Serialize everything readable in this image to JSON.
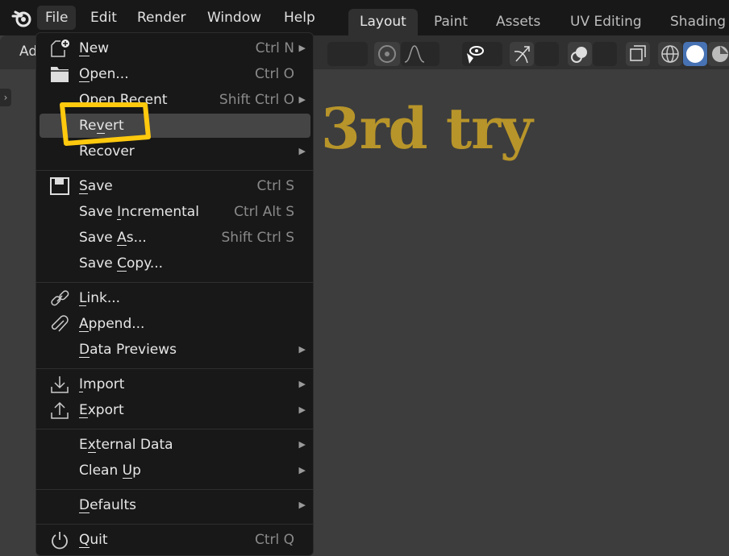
{
  "topbar": {
    "menus": [
      "File",
      "Edit",
      "Render",
      "Window",
      "Help"
    ],
    "active_menu": "File",
    "workspace_tabs": [
      "Layout",
      "Paint",
      "Assets",
      "UV Editing",
      "Shading"
    ],
    "active_tab": "Layout"
  },
  "toolbar": {
    "left_label": "Ad"
  },
  "viewport": {
    "text": "3rd try",
    "text_color": "#b8952a"
  },
  "file_menu": {
    "items": [
      {
        "label": "New",
        "u": "N",
        "shortcut": "Ctrl N",
        "submenu": true,
        "icon": "new-file-icon"
      },
      {
        "label": "Open...",
        "u": "O",
        "shortcut": "Ctrl O",
        "icon": "folder-icon"
      },
      {
        "label": "Open Recent",
        "shortcut": "Shift Ctrl O",
        "submenu": true
      },
      {
        "label": "Revert",
        "u": "v",
        "highlighted": true
      },
      {
        "label": "Recover",
        "submenu": true
      },
      {
        "label": "Save",
        "u": "S",
        "shortcut": "Ctrl S",
        "icon": "save-icon",
        "sep_before": true
      },
      {
        "label": "Save Incremental",
        "u": "I",
        "shortcut": "Ctrl Alt S"
      },
      {
        "label": "Save As...",
        "u": "A",
        "shortcut": "Shift Ctrl S"
      },
      {
        "label": "Save Copy...",
        "u": "C"
      },
      {
        "label": "Link...",
        "u": "L",
        "icon": "link-icon",
        "sep_before": true
      },
      {
        "label": "Append...",
        "u": "A",
        "icon": "paperclip-icon"
      },
      {
        "label": "Data Previews",
        "u": "D",
        "submenu": true
      },
      {
        "label": "Import",
        "u": "I",
        "submenu": true,
        "icon": "import-icon",
        "sep_before": true
      },
      {
        "label": "Export",
        "u": "E",
        "submenu": true,
        "icon": "export-icon"
      },
      {
        "label": "External Data",
        "u": "x",
        "submenu": true,
        "sep_before": true
      },
      {
        "label": "Clean Up",
        "u": "U",
        "submenu": true
      },
      {
        "label": "Defaults",
        "u": "D",
        "submenu": true,
        "sep_before": true
      },
      {
        "label": "Quit",
        "u": "Q",
        "shortcut": "Ctrl Q",
        "icon": "power-icon",
        "sep_before": true
      }
    ]
  },
  "annotation": {
    "color": "#ffc90e",
    "target": "Revert"
  }
}
